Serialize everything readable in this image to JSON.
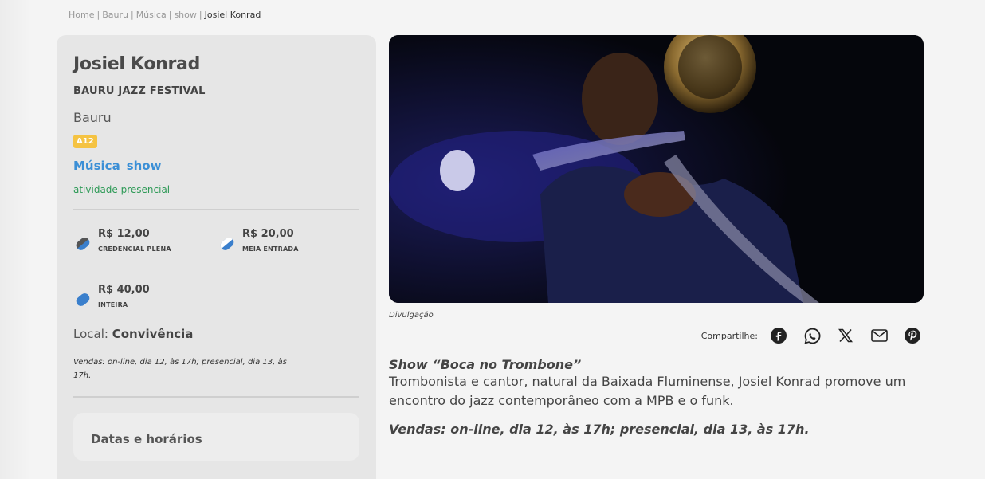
{
  "breadcrumb": {
    "items": [
      "Home",
      "Bauru",
      "Música",
      "show"
    ],
    "current": "Josiel Konrad",
    "separator": "|"
  },
  "event": {
    "title": "Josiel Konrad",
    "festival": "BAURU JAZZ FESTIVAL",
    "city": "Bauru",
    "rating": "A12",
    "categories": [
      "Música",
      "show"
    ],
    "mode": "atividade presencial"
  },
  "prices": [
    {
      "value": "R$ 12,00",
      "label": "CREDENCIAL PLENA",
      "icon": "ticket-credential-icon"
    },
    {
      "value": "R$ 20,00",
      "label": "MEIA ENTRADA",
      "icon": "ticket-half-icon"
    },
    {
      "value": "R$ 40,00",
      "label": "INTEIRA",
      "icon": "ticket-full-icon"
    }
  ],
  "local": {
    "label": "Local:",
    "name": "Convivência"
  },
  "sidebar_vendas": "Vendas: on-line, dia 12, às 17h; presencial, dia 13, às 17h.",
  "datas": {
    "title": "Datas e horários"
  },
  "image": {
    "caption": "Divulgação"
  },
  "share": {
    "label": "Compartilhe:",
    "icons": [
      "facebook-icon",
      "whatsapp-icon",
      "x-icon",
      "email-icon",
      "pinterest-icon"
    ]
  },
  "description": {
    "show_title": "Show “Boca no Trombone”",
    "text": "Trombonista e cantor, natural da Baixada Fluminense, Josiel Konrad promove um encontro do jazz contemporâneo com a MPB e o funk.",
    "vendas": "Vendas: on-line, dia 12, às 17h; presencial, dia 13, às 17h."
  },
  "colors": {
    "link": "#3b8fd6",
    "presencial": "#2e9a57",
    "rating_bg": "#f5c342",
    "ticket_dark": "#555555",
    "ticket_blue": "#3a7fcc"
  }
}
